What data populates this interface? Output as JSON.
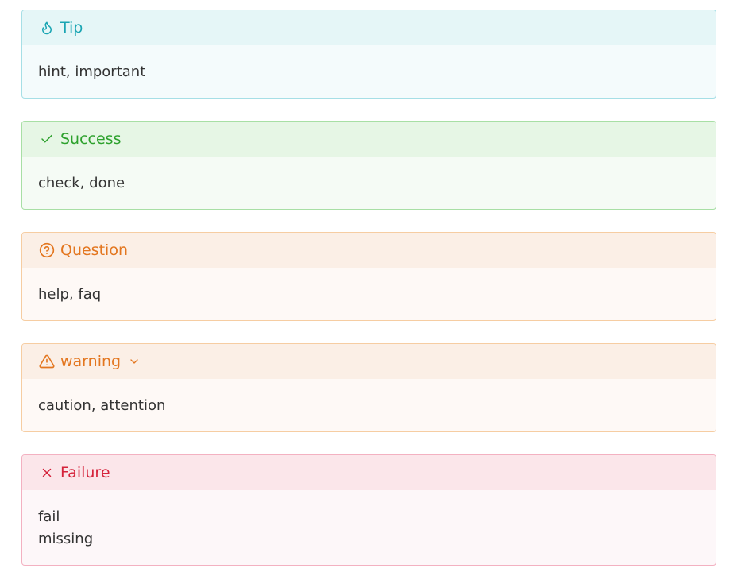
{
  "callouts": [
    {
      "title": "Tip",
      "icon": "flame-icon",
      "lines": [
        "hint, important"
      ],
      "color": "#1aa5b3",
      "collapsible": false
    },
    {
      "title": "Success",
      "icon": "check-icon",
      "lines": [
        "check, done"
      ],
      "color": "#2da12d",
      "collapsible": false
    },
    {
      "title": "Question",
      "icon": "help-circle-icon",
      "lines": [
        "help, faq"
      ],
      "color": "#e3761f",
      "collapsible": false
    },
    {
      "title": "warning",
      "icon": "alert-triangle-icon",
      "lines": [
        "caution, attention"
      ],
      "color": "#e3761f",
      "collapsible": true,
      "toggle_icon": "chevron-down-icon"
    },
    {
      "title": "Failure",
      "icon": "x-icon",
      "lines": [
        "fail",
        "missing"
      ],
      "color": "#d5233b",
      "collapsible": false
    }
  ]
}
